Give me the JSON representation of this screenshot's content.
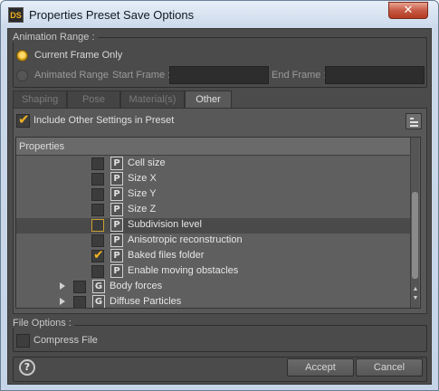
{
  "window": {
    "app_icon_text": "DS",
    "title": "Properties Preset Save Options",
    "close_glyph": "✕"
  },
  "animation_range": {
    "legend": "Animation Range :",
    "current_frame_label": "Current Frame Only",
    "animated_range_label": "Animated Range",
    "start_frame_label": "Start Frame :",
    "end_frame_label": "End Frame :",
    "start_frame_value": "",
    "end_frame_value": "",
    "selected": "Current Frame Only"
  },
  "tabs": [
    {
      "label": "Shaping",
      "active": false
    },
    {
      "label": "Pose",
      "active": false
    },
    {
      "label": "Material(s)",
      "active": false
    },
    {
      "label": "Other",
      "active": true
    }
  ],
  "include_other": {
    "label": "Include Other Settings in Preset",
    "checked": true
  },
  "properties": {
    "header": "Properties",
    "rows": [
      {
        "label": "Cell size",
        "icon": "P",
        "checked": false,
        "selected": false,
        "expandable": false
      },
      {
        "label": "Size X",
        "icon": "P",
        "checked": false,
        "selected": false,
        "expandable": false
      },
      {
        "label": "Size Y",
        "icon": "P",
        "checked": false,
        "selected": false,
        "expandable": false
      },
      {
        "label": "Size Z",
        "icon": "P",
        "checked": false,
        "selected": false,
        "expandable": false
      },
      {
        "label": "Subdivision level",
        "icon": "P",
        "checked": false,
        "selected": true,
        "expandable": false
      },
      {
        "label": "Anisotropic reconstruction",
        "icon": "P",
        "checked": false,
        "selected": false,
        "expandable": false
      },
      {
        "label": "Baked files folder",
        "icon": "P",
        "checked": true,
        "selected": false,
        "expandable": false
      },
      {
        "label": "Enable moving obstacles",
        "icon": "P",
        "checked": false,
        "selected": false,
        "expandable": false
      },
      {
        "label": "Body forces",
        "icon": "G",
        "checked": false,
        "selected": false,
        "expandable": true
      },
      {
        "label": "Diffuse Particles",
        "icon": "G",
        "checked": false,
        "selected": false,
        "expandable": true
      }
    ]
  },
  "file_options": {
    "legend": "File Options :",
    "compress_label": "Compress File",
    "compress_checked": false
  },
  "footer": {
    "help_glyph": "?",
    "accept_label": "Accept",
    "cancel_label": "Cancel"
  },
  "colors": {
    "accent": "#f0b020",
    "panel_bg": "#4b4b4b"
  }
}
